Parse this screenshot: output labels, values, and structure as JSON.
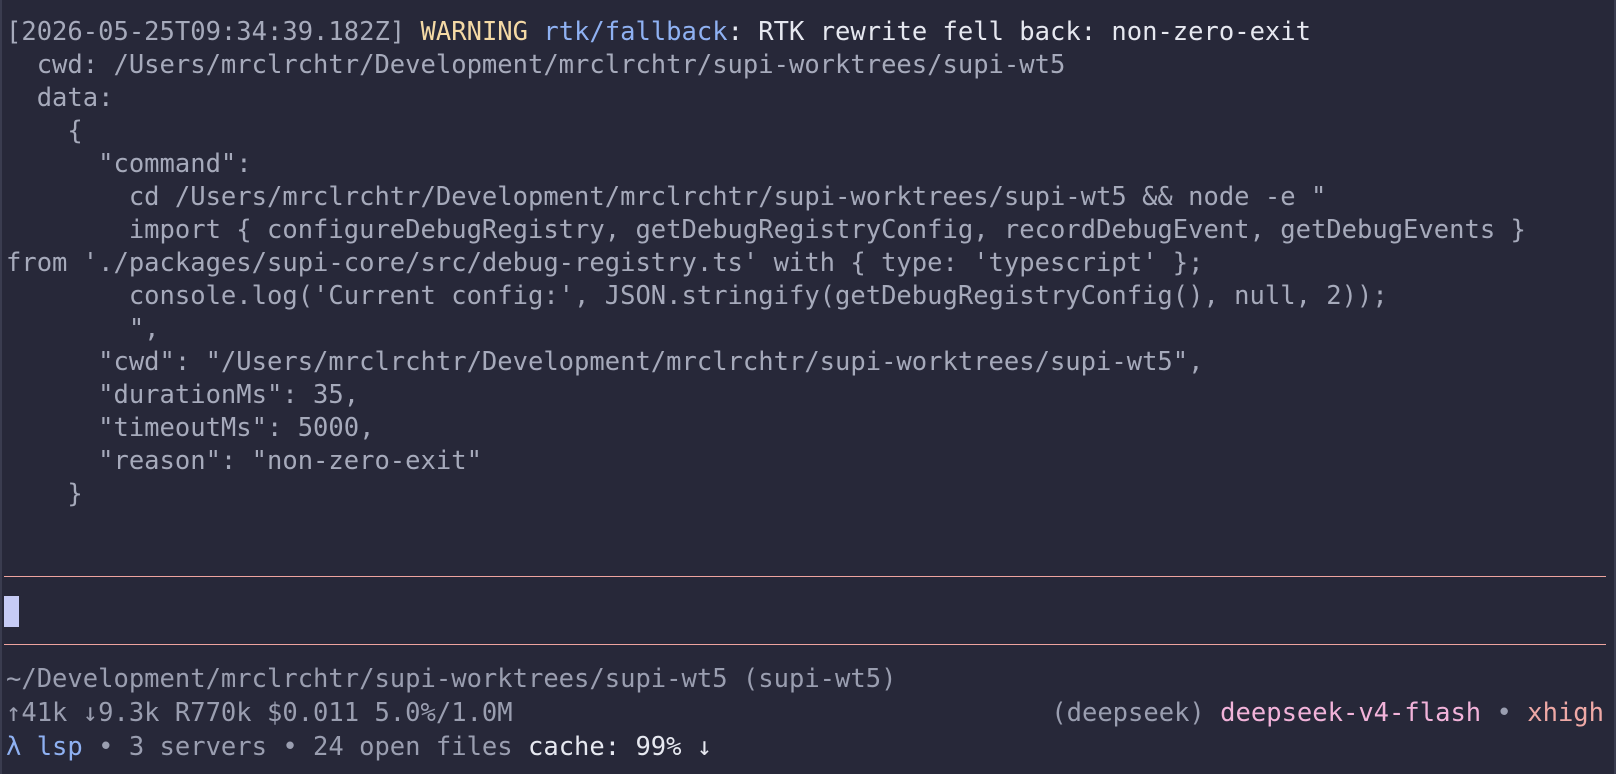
{
  "log": {
    "timestamp": "[2026-05-25T09:34:39.182Z]",
    "level": "WARNING",
    "source": "rtk/fallback",
    "message": ": RTK rewrite fell back: non-zero-exit",
    "cwd_line": "  cwd: /Users/mrclrchtr/Development/mrclrchtr/supi-worktrees/supi-wt5",
    "data_label": "  data:",
    "open_brace": "    {",
    "command_key": "      \"command\":",
    "command_lines": [
      "        cd /Users/mrclrchtr/Development/mrclrchtr/supi-worktrees/supi-wt5 && node -e \"",
      "        import { configureDebugRegistry, getDebugRegistryConfig, recordDebugEvent, getDebugEvents }",
      "from './packages/supi-core/src/debug-registry.ts' with { type: 'typescript' };",
      "        console.log('Current config:', JSON.stringify(getDebugRegistryConfig(), null, 2));",
      "        \","
    ],
    "cwd_field": "      \"cwd\": \"/Users/mrclrchtr/Development/mrclrchtr/supi-worktrees/supi-wt5\",",
    "duration_field": "      \"durationMs\": 35,",
    "timeout_field": "      \"timeoutMs\": 5000,",
    "reason_field": "      \"reason\": \"non-zero-exit\"",
    "close_brace": "    }"
  },
  "footer": {
    "path": "~/Development/mrclrchtr/supi-worktrees/supi-wt5 (supi-wt5)",
    "usage": "↑41k ↓9.3k R770k $0.011 5.0%/1.0M",
    "provider": "(deepseek)",
    "model": "deepseek-v4-flash",
    "bullet": "•",
    "thinking": "xhigh",
    "lsp_prompt": "λ lsp",
    "lsp_info": " • 3 servers • 24 open files",
    "cache": " cache: 99% ↓"
  },
  "colors": {
    "background": "#272839",
    "warning": "#f4d9a5",
    "source": "#8fb1f2",
    "separator": "#eea49f",
    "model": "#f2b3da",
    "cursor": "#c6cbf5"
  }
}
